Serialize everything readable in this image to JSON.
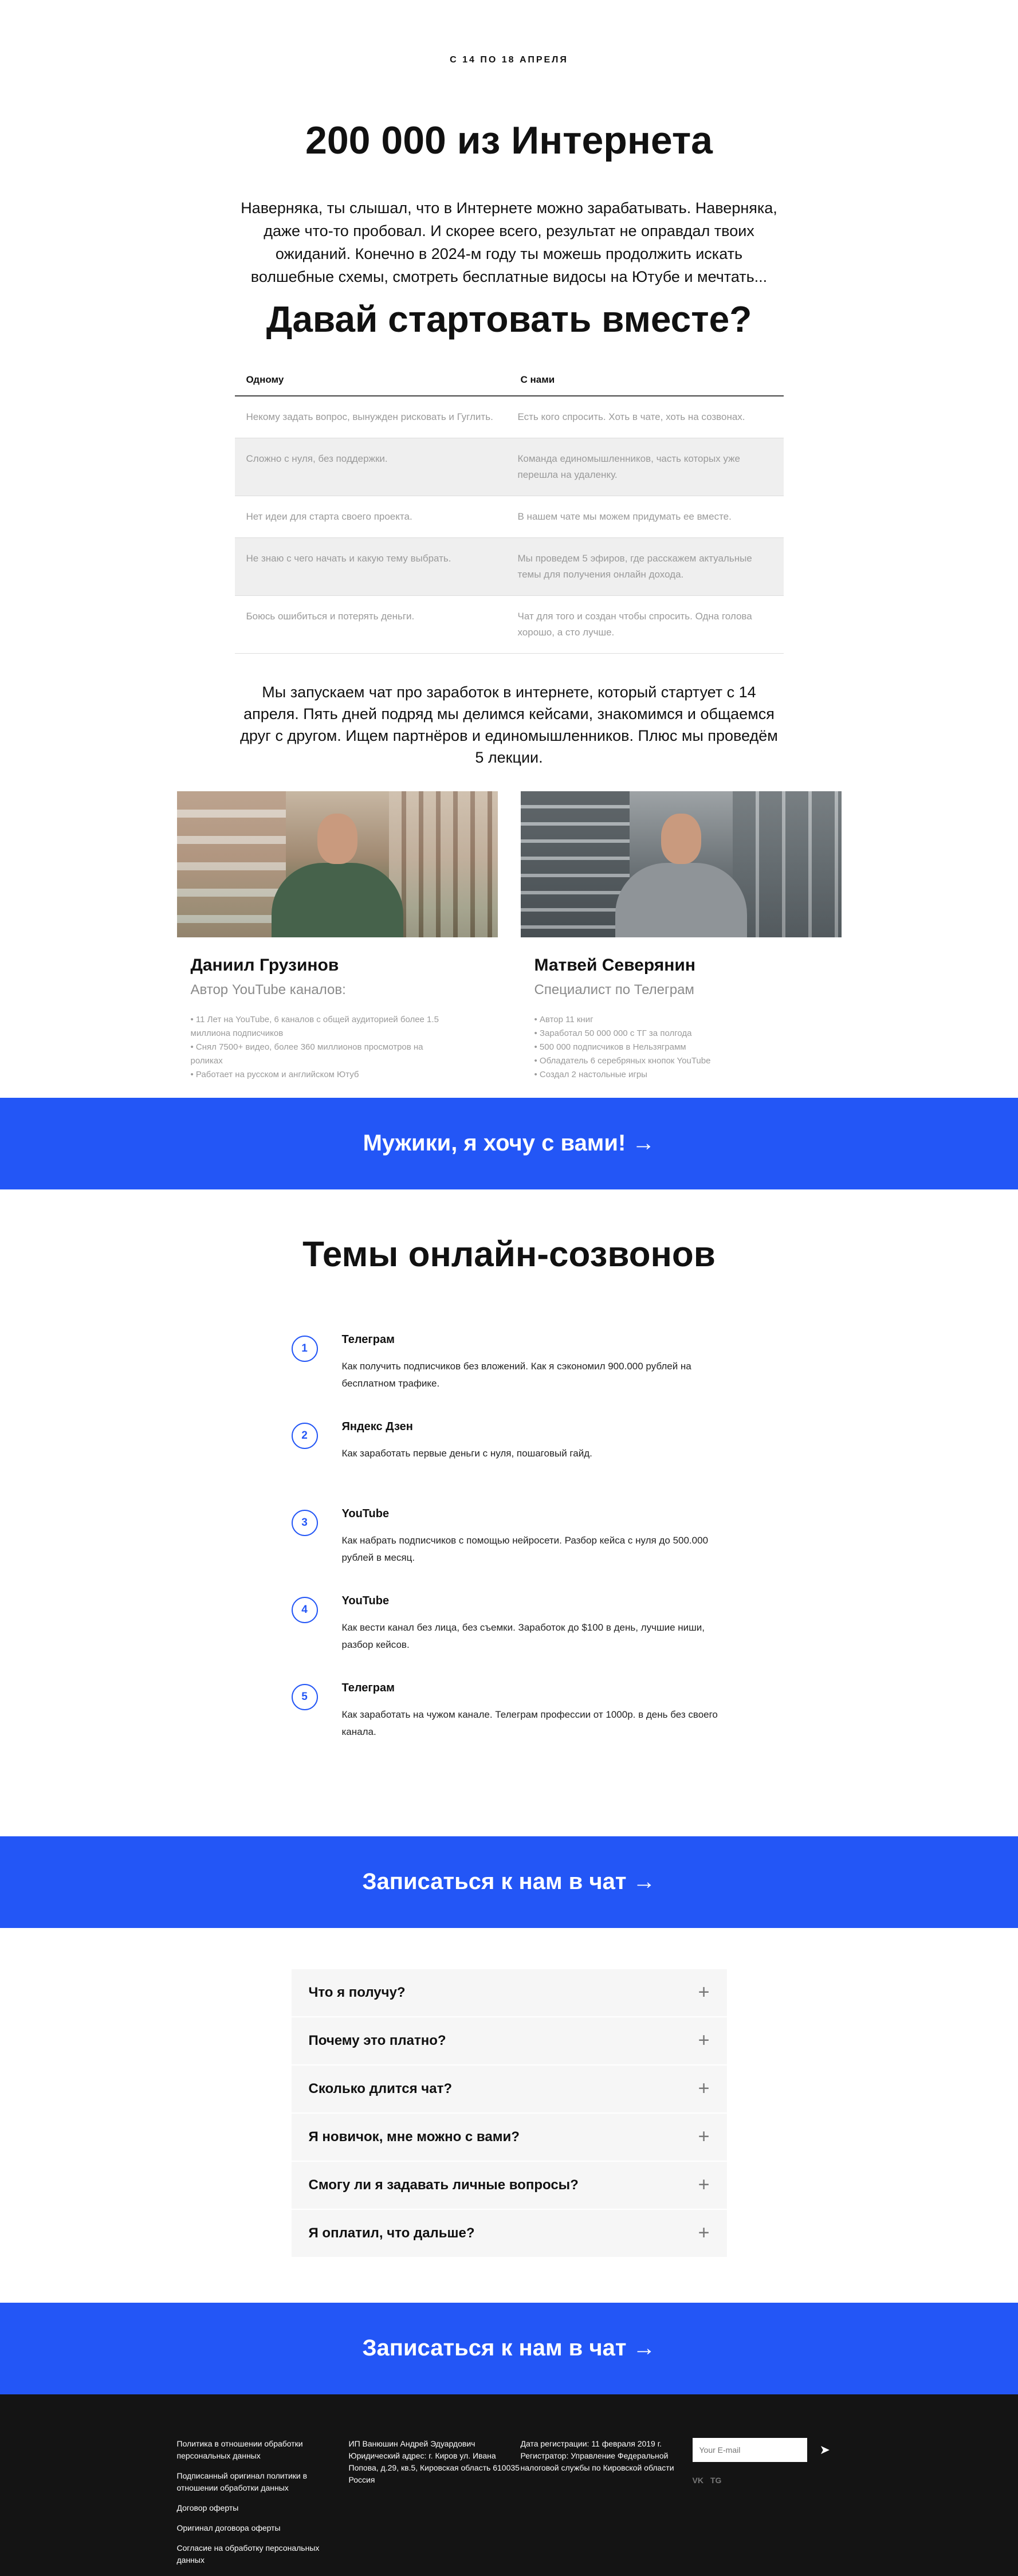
{
  "hero": {
    "eyebrow": "С 14 ПО 18 АПРЕЛЯ",
    "title": "200 000 из Интернета",
    "text": "Наверняка, ты слышал, что в Интернете можно зарабатывать. Наверняка, даже что-то пробовал. И скорее всего, результат не оправдал твоих ожиданий. Конечно в 2024-м году ты можешь продолжить искать волшебные схемы, смотреть бесплатные видосы на Ютубе и мечтать...",
    "subtitle": "Давай стартовать вместе?"
  },
  "compare": {
    "headers": [
      "Одному",
      "С нами"
    ],
    "rows": [
      [
        "Некому задать вопрос, вынужден рисковать и Гуглить.",
        "Есть кого спросить. Хоть в чате, хоть на созвонах."
      ],
      [
        "Сложно с нуля, без поддержки.",
        "Команда единомышленников, часть которых уже перешла на удаленку."
      ],
      [
        "Нет идеи для старта своего проекта.",
        "В нашем чате мы можем придумать ее вместе."
      ],
      [
        "Не знаю с чего начать и какую тему выбрать.",
        "Мы проведем 5 эфиров, где расскажем актуальные темы для получения онлайн дохода."
      ],
      [
        "Боюсь ошибиться и потерять деньги.",
        "Чат для того и создан чтобы спросить. Одна голова хорошо, а сто лучше."
      ]
    ]
  },
  "chat_text": "Мы запускаем чат про заработок в интернете, который стартует с 14 апреля. Пять дней подряд мы делимся кейсами, знакомимся и общаемся друг с другом. Ищем партнёров и единомышленников. Плюс мы проведём 5 лекции.",
  "people": [
    {
      "name": "Даниил Грузинов",
      "role": "Автор YouTube каналов:",
      "facts": [
        "• 11 Лет на YouTube, 6 каналов с общей аудиторией более 1.5",
        "миллиона подписчиков",
        "• Снял 7500+ видео, более 360 миллионов просмотров на",
        "роликах",
        "• Работает на русском и английском Ютуб"
      ]
    },
    {
      "name": "Матвей Северянин",
      "role": "Специалист по Телеграм",
      "facts": [
        "• Автор 11 книг",
        "• Заработал 50 000 000 с ТГ за полгода",
        "• 500 000 подписчиков в Нельзяграмм",
        "• Обладатель 6 серебряных кнопок YouTube",
        "• Создал 2 настольные игры"
      ]
    }
  ],
  "cta1": "Мужики, я хочу с вами! →",
  "topics_title": "Темы онлайн-созвонов",
  "topics": [
    {
      "num": "1",
      "name": "Телеграм",
      "desc": "Как получить подписчиков без вложений. Как я сэкономил 900.000 рублей на бесплатном трафике."
    },
    {
      "num": "2",
      "name": "Яндекс Дзен",
      "desc": "Как заработать первые деньги с нуля, пошаговый гайд."
    },
    {
      "num": "3",
      "name": "YouTube",
      "desc": "Как набрать подписчиков с помощью нейросети. Разбор кейса с нуля до 500.000 рублей в месяц."
    },
    {
      "num": "4",
      "name": "YouTube",
      "desc": "Как вести канал без лица, без съемки. Заработок до $100 в день, лучшие ниши, разбор кейсов."
    },
    {
      "num": "5",
      "name": "Телеграм",
      "desc": "Как заработать на чужом канале. Телеграм профессии от 1000р. в день без своего канала."
    }
  ],
  "cta2": "Записаться к нам в чат →",
  "faq": [
    "Что я получу?",
    "Почему это платно?",
    "Сколько длится чат?",
    "Я новичок, мне можно с вами?",
    "Смогу ли я задавать личные вопросы?",
    "Я оплатил, что дальше?"
  ],
  "cta3": "Записаться к нам в чат →",
  "footer": {
    "links": [
      "Политика в отношении обработки персональных данных",
      "Подписанный оригинал политики в отношении обработки данных",
      "Договор оферты",
      "Оригинал договора оферты",
      "Согласие на обработку персональных данных"
    ],
    "legal": "ИП Ванюшин Андрей Эдуардович Юридический адрес: г. Киров ул. Ивана Попова, д.29, кв.5, Кировская область 610035 Россия",
    "registration": "Дата регистрации: 11 февраля 2019 г. Регистратор: Управление Федеральной налоговой службы по Кировской области",
    "email_placeholder": "Your E-mail",
    "social_vk": "VK",
    "social_tg": "TG"
  }
}
